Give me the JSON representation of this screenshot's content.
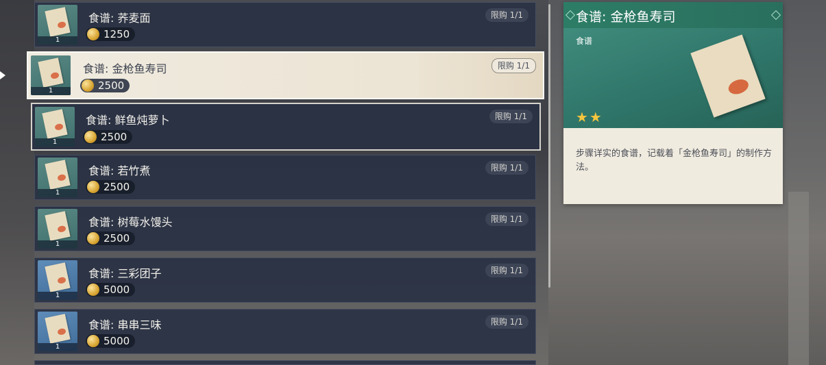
{
  "shop": {
    "items": [
      {
        "name": "食谱: 荞麦面",
        "price": "1250",
        "limit": "限购 1/1",
        "qty": "1"
      },
      {
        "name": "食谱: 金枪鱼寿司",
        "price": "2500",
        "limit": "限购 1/1",
        "qty": "1"
      },
      {
        "name": "食谱: 鲜鱼炖萝卜",
        "price": "2500",
        "limit": "限购 1/1",
        "qty": "1"
      },
      {
        "name": "食谱: 若竹煮",
        "price": "2500",
        "limit": "限购 1/1",
        "qty": "1"
      },
      {
        "name": "食谱: 树莓水馒头",
        "price": "2500",
        "limit": "限购 1/1",
        "qty": "1"
      },
      {
        "name": "食谱: 三彩团子",
        "price": "5000",
        "limit": "限购 1/1",
        "qty": "1"
      },
      {
        "name": "食谱: 串串三味",
        "price": "5000",
        "limit": "限购 1/1",
        "qty": "1"
      }
    ]
  },
  "detail": {
    "title": "食谱: 金枪鱼寿司",
    "type": "食谱",
    "stars": "★★",
    "description": "步骤详实的食谱，记载着「金枪鱼寿司」的制作方法。"
  },
  "colors": {
    "header_green": "#2d7d66",
    "coin_gold": "#d8a533",
    "star_gold": "#f4c53e"
  }
}
